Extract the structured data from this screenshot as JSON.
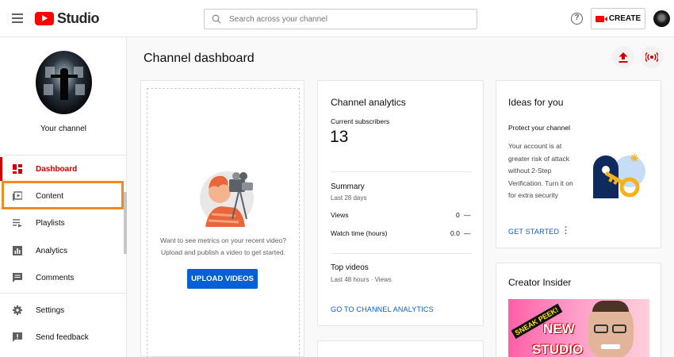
{
  "app": {
    "name": "Studio"
  },
  "search": {
    "placeholder": "Search across your channel"
  },
  "header": {
    "create_label": "CREATE"
  },
  "sidebar": {
    "channel_label": "Your channel",
    "items": [
      {
        "label": "Dashboard",
        "icon": "dashboard-icon",
        "active": true
      },
      {
        "label": "Content",
        "icon": "content-icon"
      },
      {
        "label": "Playlists",
        "icon": "playlists-icon"
      },
      {
        "label": "Analytics",
        "icon": "analytics-icon"
      },
      {
        "label": "Comments",
        "icon": "comments-icon"
      },
      {
        "label": "Settings",
        "icon": "settings-icon"
      },
      {
        "label": "Send feedback",
        "icon": "feedback-icon"
      }
    ]
  },
  "main": {
    "title": "Channel dashboard"
  },
  "upload_card": {
    "text_line1": "Want to see metrics on your recent video?",
    "text_line2": "Upload and publish a video to get started.",
    "button": "UPLOAD VIDEOS"
  },
  "analytics": {
    "title": "Channel analytics",
    "subscribers_label": "Current subscribers",
    "subscribers": "13",
    "summary_title": "Summary",
    "summary_period": "Last 28 days",
    "rows": [
      {
        "label": "Views",
        "value": "0",
        "trend": "—"
      },
      {
        "label": "Watch time (hours)",
        "value": "0.0",
        "trend": "—"
      }
    ],
    "top_title": "Top videos",
    "top_period": "Last 48 hours · Views",
    "link": "GO TO CHANNEL ANALYTICS"
  },
  "ideas": {
    "title": "Ideas for you",
    "subtitle": "Protect your channel",
    "body": [
      "Your account is at",
      "greater risk of attack",
      "without 2-Step",
      "Verification. Turn it on",
      "for extra security"
    ],
    "cta": "GET STARTED"
  },
  "creator": {
    "title": "Creator Insider",
    "thumb_text1": "SNEAK PEEK!",
    "thumb_text2": "NEW",
    "thumb_text3": "STUDIO"
  }
}
